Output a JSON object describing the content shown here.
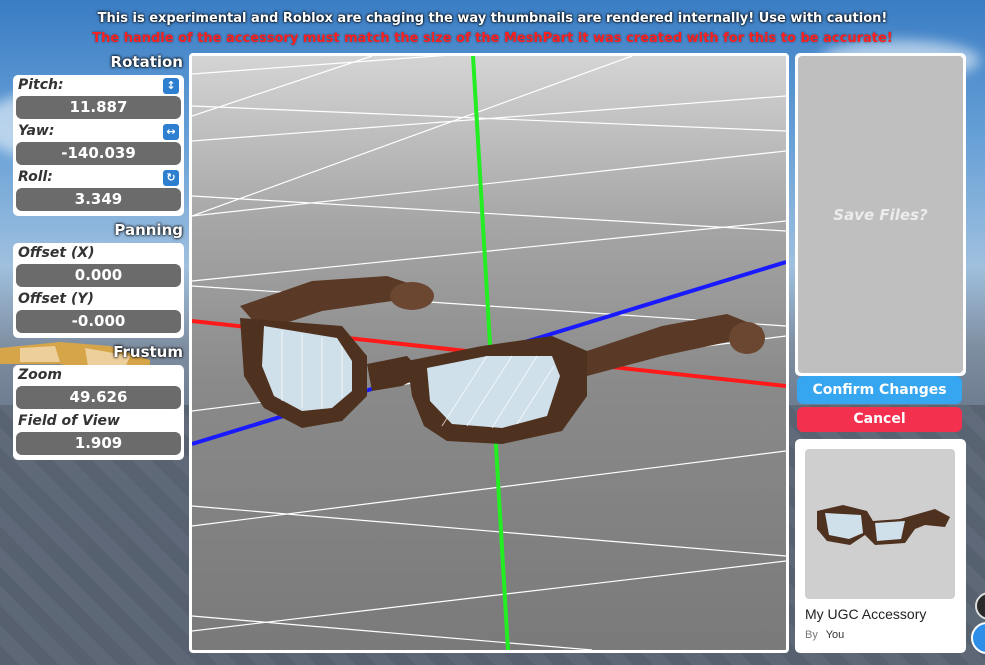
{
  "banner": {
    "warning": "This is experimental and Roblox are chaging the way thumbnails are rendered internally! Use with caution!",
    "note": "The handle of the accessory must match the size of the MeshPart it was created with for this to be accurate!"
  },
  "rotation": {
    "title": "Rotation",
    "pitch": {
      "label": "Pitch:",
      "value": "11.887",
      "icon": "vertical-arrows-icon"
    },
    "yaw": {
      "label": "Yaw:",
      "value": "-140.039",
      "icon": "horizontal-arrows-icon"
    },
    "roll": {
      "label": "Roll:",
      "value": "3.349",
      "icon": "rotate-icon"
    }
  },
  "panning": {
    "title": "Panning",
    "offset_x": {
      "label": "Offset (X)",
      "value": "0.000"
    },
    "offset_y": {
      "label": "Offset (Y)",
      "value": "-0.000"
    }
  },
  "frustum": {
    "title": "Frustum",
    "zoom": {
      "label": "Zoom",
      "value": "49.626"
    },
    "fov": {
      "label": "Field of View",
      "value": "1.909"
    }
  },
  "save": {
    "label": "Save Files?"
  },
  "actions": {
    "confirm": "Confirm Changes",
    "cancel": "Cancel"
  },
  "item": {
    "name": "My UGC Accessory",
    "by_label": "By",
    "creator": "You"
  },
  "colors": {
    "confirm": "#37a6f0",
    "cancel": "#f4304f",
    "axis_x": "#ff1a1a",
    "axis_y": "#22ee22",
    "axis_z": "#1a1aff",
    "field_bg": "#6b6b6b",
    "glasses_frame": "#5a3a26"
  }
}
